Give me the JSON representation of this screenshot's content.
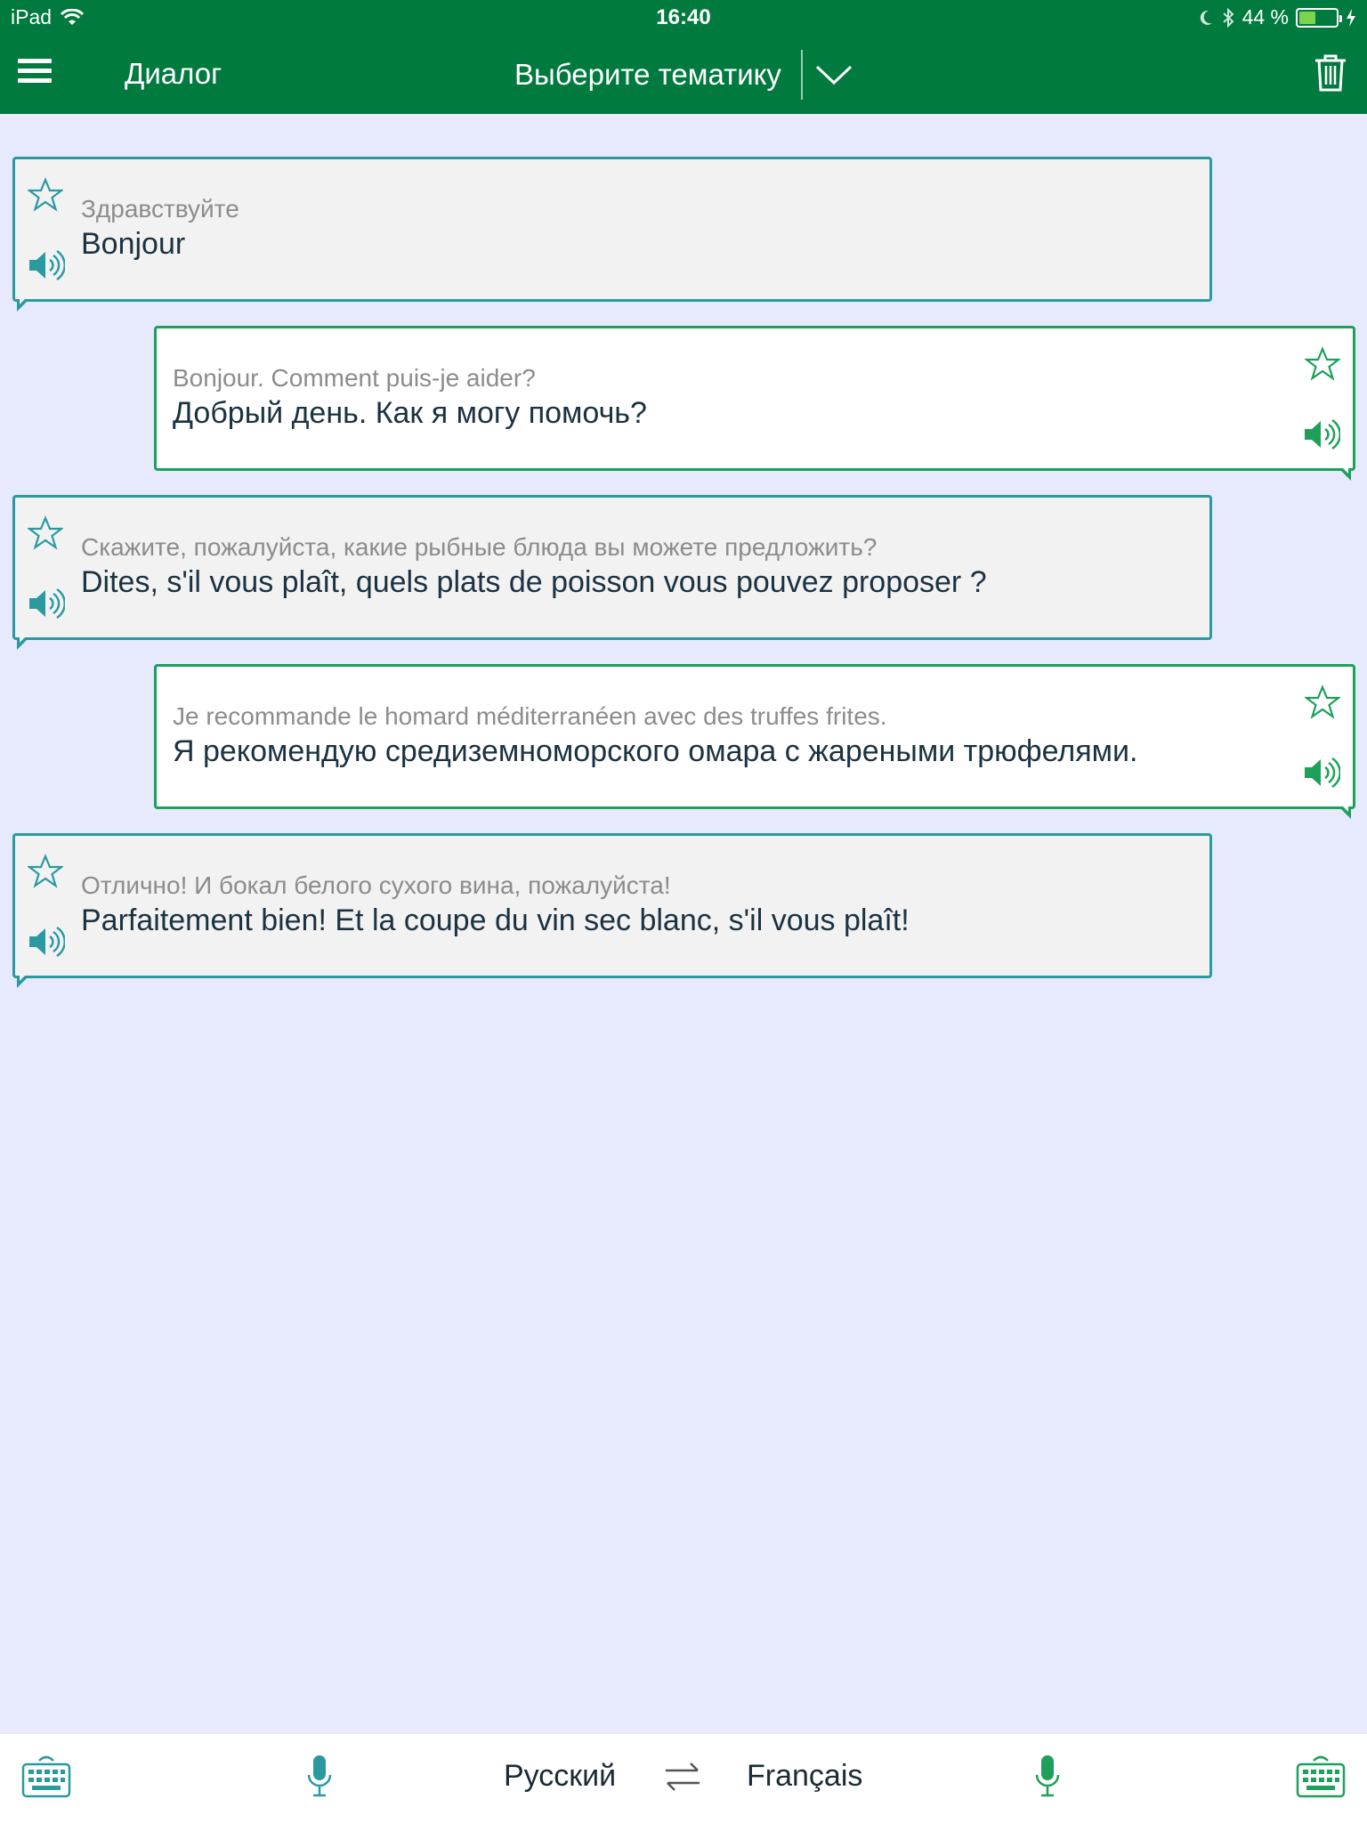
{
  "status_bar": {
    "device": "iPad",
    "time": "16:40",
    "battery": "44 %",
    "battery_level": 0.44
  },
  "nav": {
    "title": "Диалог",
    "topic_placeholder": "Выберите тематику"
  },
  "messages": [
    {
      "side": "left",
      "source": "Здравствуйте",
      "target": "Bonjour"
    },
    {
      "side": "right",
      "source": "Bonjour. Comment puis-je aider?",
      "target": "Добрый день. Как я могу помочь?"
    },
    {
      "side": "left",
      "source": "Скажите, пожалуйста, какие рыбные блюда вы можете предложить?",
      "target": "Dites, s'il vous plaît, quels plats de poisson vous pouvez proposer ?"
    },
    {
      "side": "right",
      "source": "Je recommande le homard méditerranéen avec des truffes frites.",
      "target": "Я рекомендую средиземноморского омара с жареными трюфелями."
    },
    {
      "side": "left",
      "source": "Отлично! И бокал белого сухого вина, пожалуйста!",
      "target": "Parfaitement bien! Et la coupe du vin sec blanc, s'il vous plaît!"
    }
  ],
  "bottom": {
    "source_language": "Русский",
    "target_language": "Français"
  },
  "colors": {
    "header": "#007a3e",
    "left_accent": "#2b9aa0",
    "right_accent": "#1da05a",
    "background": "#e7e9fd"
  },
  "icons": {
    "menu": "hamburger-icon",
    "chevron": "chevron-down-icon",
    "trash": "trash-icon",
    "star": "star-outline-icon",
    "speaker": "speaker-icon",
    "keyboard": "keyboard-icon",
    "mic": "microphone-icon",
    "swap": "swap-arrows-icon"
  }
}
